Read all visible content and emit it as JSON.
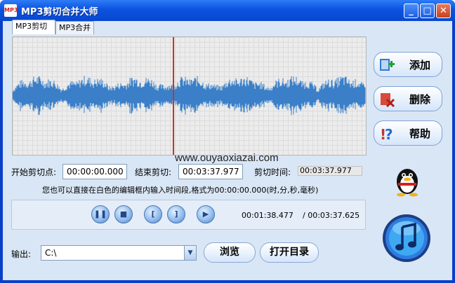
{
  "window": {
    "title": "MP3剪切合并大师",
    "icon_text": "MP3",
    "controls": [
      "_",
      "□",
      "✕"
    ]
  },
  "tabs": [
    {
      "label": "MP3剪切",
      "active": true
    },
    {
      "label": "MP3合并",
      "active": false
    }
  ],
  "waveform": {
    "color": "#3a7fc8",
    "cursor_color": "#c0392b",
    "watermark": "www.ouyaoxiazai.com"
  },
  "side_buttons": [
    {
      "label": "添加",
      "icon": "add-file-icon"
    },
    {
      "label": "删除",
      "icon": "delete-icon"
    },
    {
      "label": "帮助",
      "icon": "help-icon"
    }
  ],
  "cut": {
    "start_label": "开始剪切点:",
    "start_value": "00:00:00.000",
    "end_label": "结束剪切:",
    "end_value": "00:03:37.977",
    "duration_label": "剪切时间:",
    "duration_value": "00:03:37.977",
    "hint": "您也可以直接在白色的编辑框内输入时间段,格式为00:00:00.000(时,分,秒,毫秒)"
  },
  "player": {
    "buttons": [
      {
        "name": "pause",
        "glyph": "❚❚"
      },
      {
        "name": "stop",
        "glyph": "■"
      },
      {
        "name": "mark-start",
        "glyph": "["
      },
      {
        "name": "mark-end",
        "glyph": "]"
      },
      {
        "name": "play-selection",
        "glyph": "▶"
      }
    ],
    "current_time": "00:01:38.477",
    "total_time": "/ 00:03:37.625"
  },
  "output": {
    "label": "输出:",
    "path": "C:\\",
    "browse_label": "浏览",
    "open_dir_label": "打开目录"
  },
  "colors": {
    "title_bar": "#0b53e0",
    "client_bg": "#d9e6f5",
    "accent": "#1b5ee8"
  }
}
